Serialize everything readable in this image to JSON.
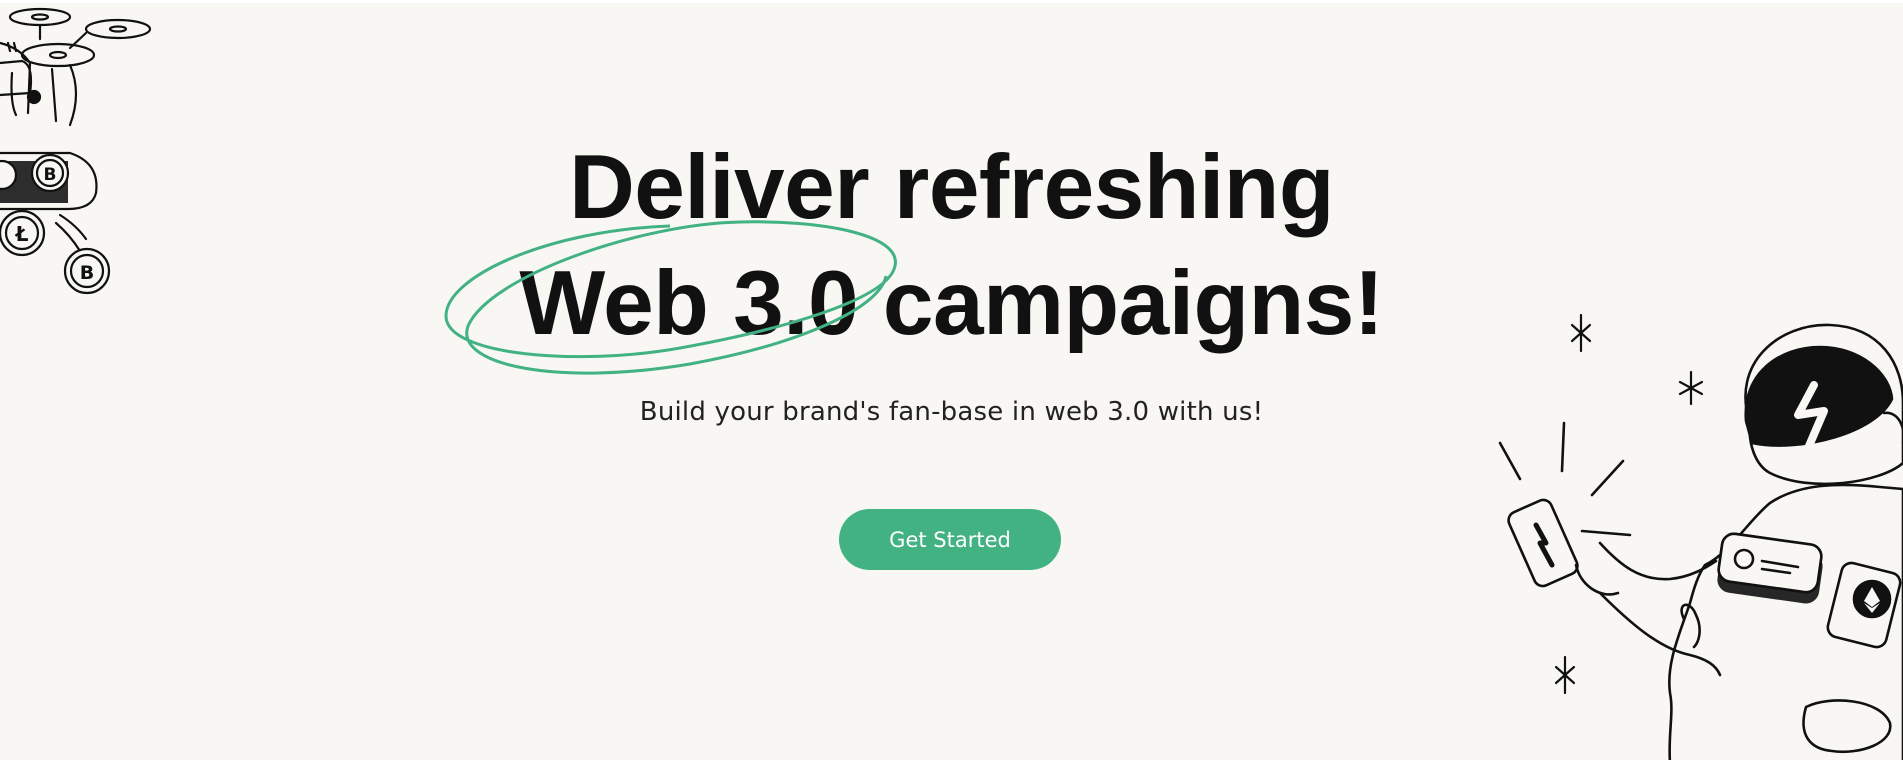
{
  "hero": {
    "headline_line1": "Deliver refreshing",
    "headline_highlight": "Web 3.0",
    "headline_line2_rest": " campaigns!",
    "subtitle": "Build your brand's fan-base in web 3.0 with us!",
    "cta_label": "Get Started"
  },
  "colors": {
    "accent": "#43b283",
    "background": "#f8f7f3",
    "text": "#111111"
  },
  "icons": {
    "left_illustration": "crypto-drone-icon",
    "right_illustration": "astronaut-phone-icon",
    "decorations": "sparkle-icon"
  }
}
